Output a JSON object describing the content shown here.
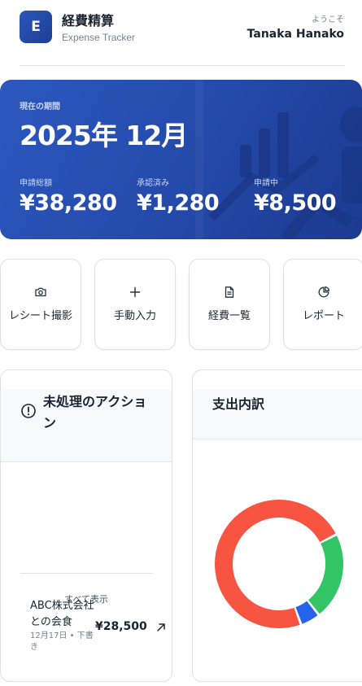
{
  "header": {
    "logo_letter": "E",
    "app_title": "経費精算",
    "app_subtitle": "Expense Tracker",
    "welcome": "ようこそ",
    "user_name": "Tanaka Hanako"
  },
  "hero": {
    "period_label": "現在の期間",
    "period": "2025年 12月",
    "stats": [
      {
        "label": "申請総額",
        "value": "¥38,280"
      },
      {
        "label": "承認済み",
        "value": "¥1,280"
      },
      {
        "label": "申請中",
        "value": "¥8,500"
      }
    ]
  },
  "quick_actions": [
    {
      "label": "レシート撮影",
      "icon": "camera-icon"
    },
    {
      "label": "手動入力",
      "icon": "plus-icon"
    },
    {
      "label": "経費一覧",
      "icon": "document-icon"
    },
    {
      "label": "レポート",
      "icon": "pie-chart-icon"
    }
  ],
  "pending": {
    "title": "未処理のアクション",
    "item": {
      "title": "ABC株式会社との会食",
      "meta": "12月17日 • 下書き",
      "amount": "¥28,500"
    },
    "view_all": "すべて表示"
  },
  "breakdown": {
    "title": "支出内訳",
    "segments": [
      {
        "share": 0.73,
        "color": "#f75441"
      },
      {
        "share": 0.22,
        "color": "#33c466"
      },
      {
        "share": 0.05,
        "color": "#2563eb"
      }
    ]
  },
  "colors": {
    "brand": "#2449a9",
    "accent_red": "#f75441",
    "accent_green": "#33c466",
    "accent_blue": "#2563eb"
  }
}
